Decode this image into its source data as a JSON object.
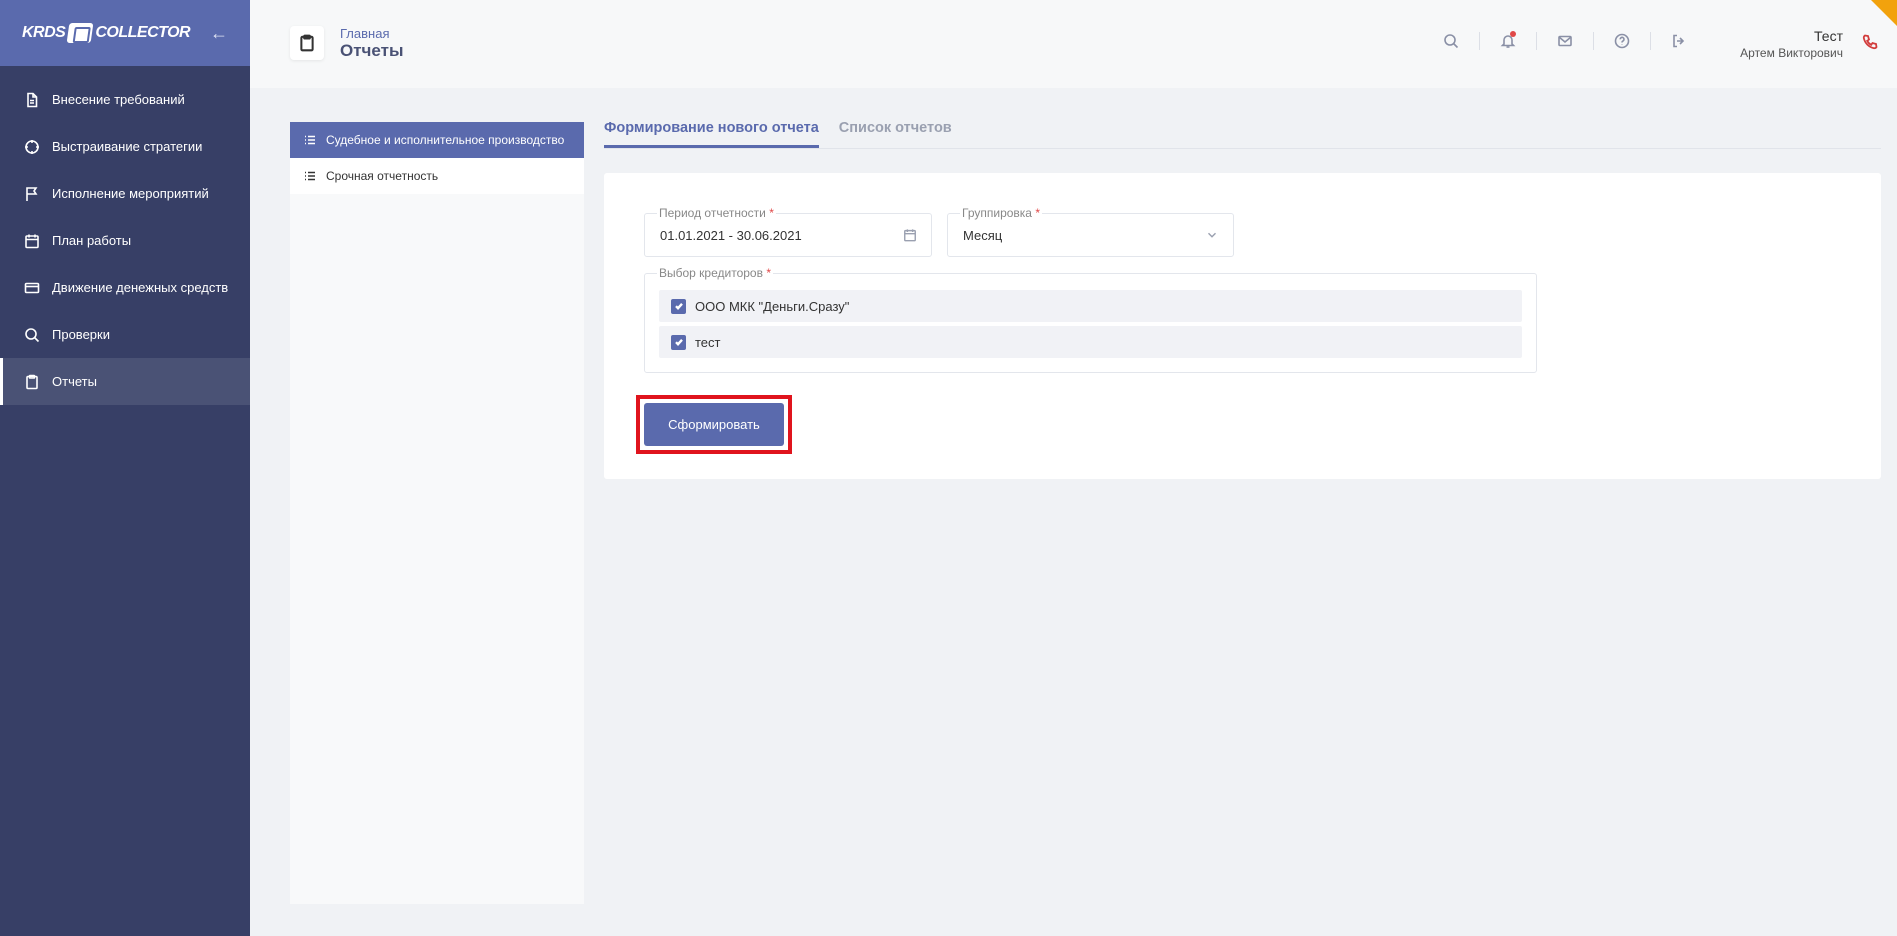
{
  "sidebar": {
    "logo_left": "KRDS",
    "logo_right": "COLLECTOR",
    "items": [
      {
        "label": "Внесение требований",
        "icon": "document-icon"
      },
      {
        "label": "Выстраивание стратегии",
        "icon": "crosshair-icon"
      },
      {
        "label": "Исполнение мероприятий",
        "icon": "flag-icon"
      },
      {
        "label": "План работы",
        "icon": "calendar-icon"
      },
      {
        "label": "Движение денежных средств",
        "icon": "credit-card-icon"
      },
      {
        "label": "Проверки",
        "icon": "search-icon"
      },
      {
        "label": "Отчеты",
        "icon": "clipboard-icon",
        "active": true
      }
    ]
  },
  "header": {
    "breadcrumb": "Главная",
    "title": "Отчеты",
    "user_name": "Тест",
    "user_sub": "Артем Викторович"
  },
  "report_menu": {
    "items": [
      {
        "label": "Судебное и исполнительное производство",
        "active": true
      },
      {
        "label": "Срочная отчетность",
        "active": false
      }
    ]
  },
  "tabs": [
    {
      "label": "Формирование нового отчета",
      "active": true
    },
    {
      "label": "Список отчетов",
      "active": false
    }
  ],
  "form": {
    "period_label": "Период отчетности",
    "period_value": "01.01.2021 - 30.06.2021",
    "grouping_label": "Группировка",
    "grouping_value": "Месяц",
    "creditors_label": "Выбор кредиторов",
    "required_mark": "*",
    "creditors": [
      {
        "name": "ООО МКК \"Деньги.Сразу\"",
        "checked": true
      },
      {
        "name": "тест",
        "checked": true
      }
    ],
    "submit_label": "Сформировать"
  },
  "colors": {
    "accent": "#5a6aad",
    "sidebar_bg": "#373f66",
    "highlight": "#e0141d",
    "corner": "#f2a20d"
  }
}
